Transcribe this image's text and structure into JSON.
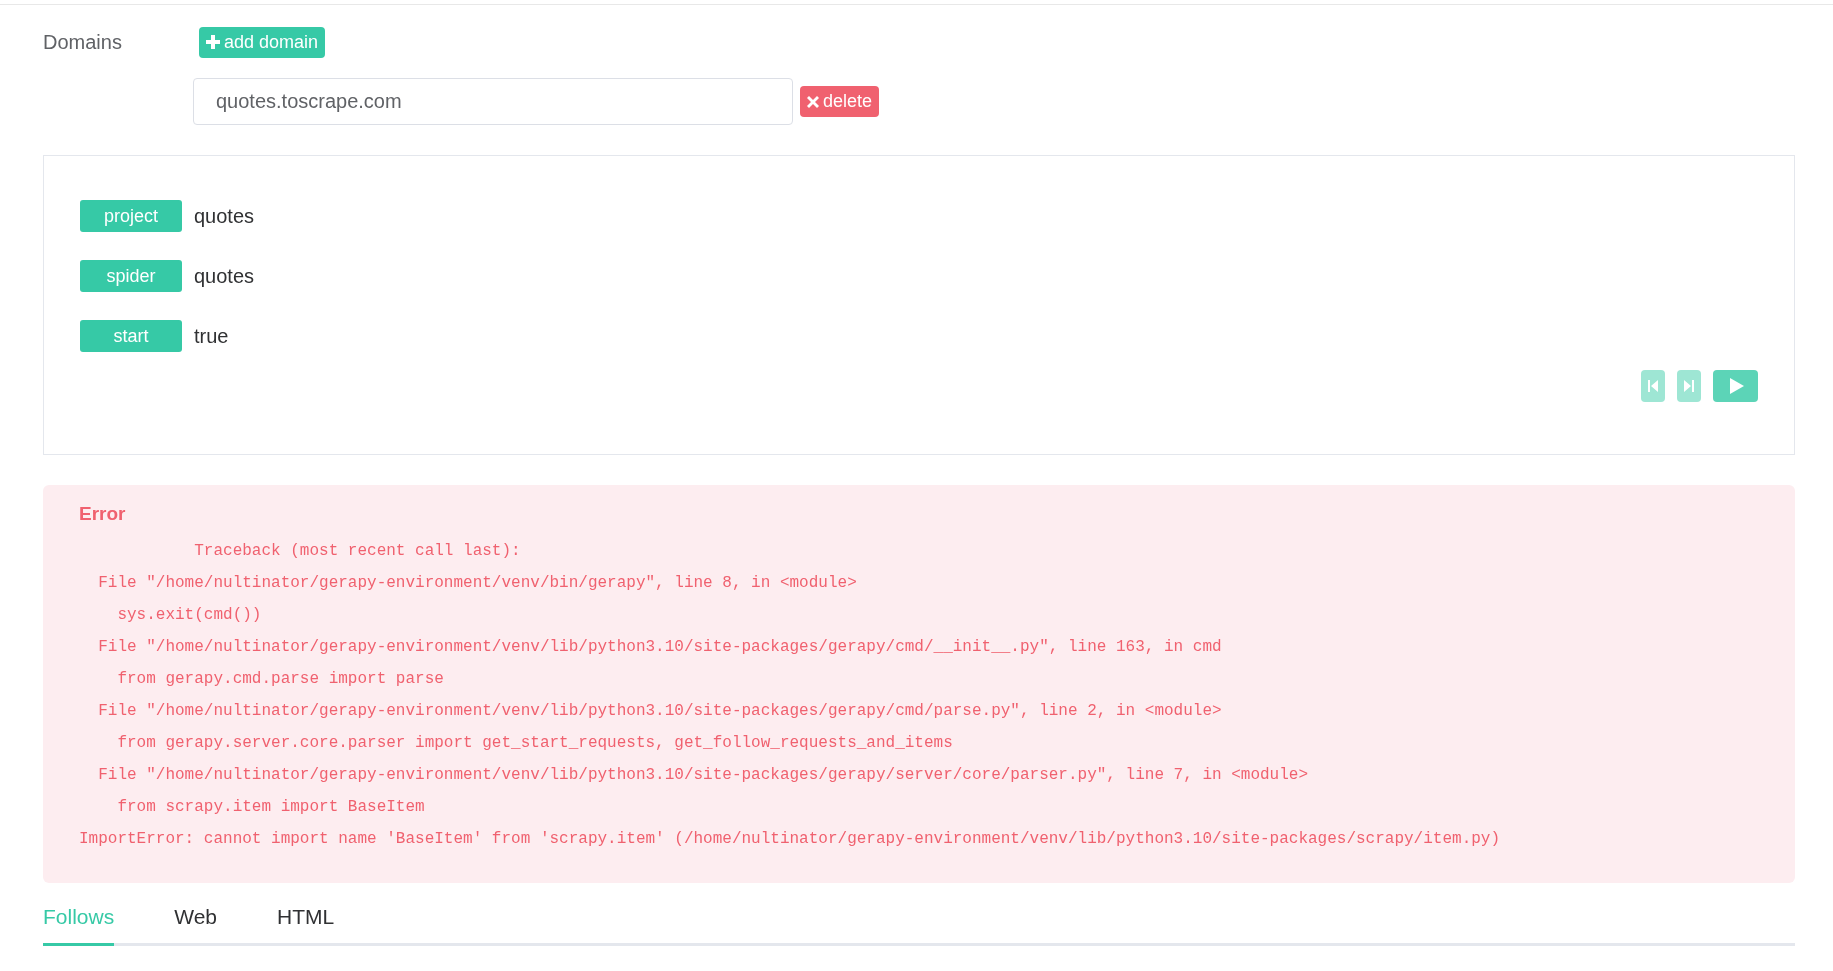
{
  "domains": {
    "label": "Domains",
    "add_button": "add domain",
    "items": [
      {
        "value": "quotes.toscrape.com",
        "delete_button": "delete"
      }
    ]
  },
  "info": [
    {
      "key": "project",
      "value": "quotes"
    },
    {
      "key": "spider",
      "value": "quotes"
    },
    {
      "key": "start",
      "value": "true"
    }
  ],
  "controls": [
    {
      "kind": "step-back",
      "disabled": true
    },
    {
      "kind": "step-forward",
      "disabled": true
    },
    {
      "kind": "play",
      "disabled": false
    }
  ],
  "error": {
    "title": "Error",
    "lines": [
      "            Traceback (most recent call last):",
      "  File \"/home/nultinator/gerapy-environment/venv/bin/gerapy\", line 8, in <module>",
      "    sys.exit(cmd())",
      "  File \"/home/nultinator/gerapy-environment/venv/lib/python3.10/site-packages/gerapy/cmd/__init__.py\", line 163, in cmd",
      "    from gerapy.cmd.parse import parse",
      "  File \"/home/nultinator/gerapy-environment/venv/lib/python3.10/site-packages/gerapy/cmd/parse.py\", line 2, in <module>",
      "    from gerapy.server.core.parser import get_start_requests, get_follow_requests_and_items",
      "  File \"/home/nultinator/gerapy-environment/venv/lib/python3.10/site-packages/gerapy/server/core/parser.py\", line 7, in <module>",
      "    from scrapy.item import BaseItem",
      "ImportError: cannot import name 'BaseItem' from 'scrapy.item' (/home/nultinator/gerapy-environment/venv/lib/python3.10/site-packages/scrapy/item.py)"
    ]
  },
  "tabs": [
    {
      "label": "Follows",
      "selected": true
    },
    {
      "label": "Web",
      "selected": false
    },
    {
      "label": "HTML",
      "selected": false
    }
  ]
}
